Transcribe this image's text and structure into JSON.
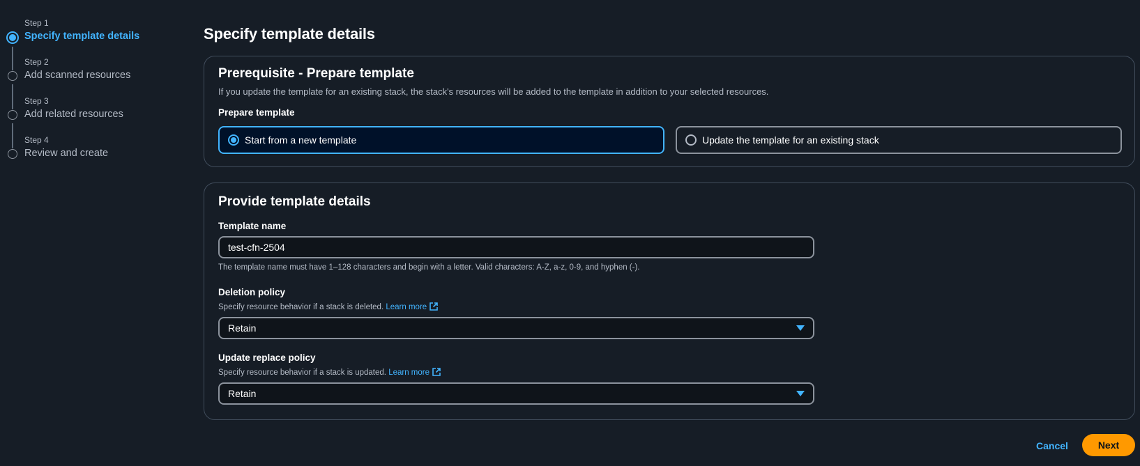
{
  "steps": [
    {
      "sub": "Step 1",
      "title": "Specify template details",
      "active": true
    },
    {
      "sub": "Step 2",
      "title": "Add scanned resources",
      "active": false
    },
    {
      "sub": "Step 3",
      "title": "Add related resources",
      "active": false
    },
    {
      "sub": "Step 4",
      "title": "Review and create",
      "active": false
    }
  ],
  "page_title": "Specify template details",
  "prerequisite": {
    "title": "Prerequisite - Prepare template",
    "description": "If you update the template for an existing stack, the stack's resources will be added to the template in addition to your selected resources.",
    "label": "Prepare template",
    "options": [
      {
        "label": "Start from a new template",
        "selected": true
      },
      {
        "label": "Update the template for an existing stack",
        "selected": false
      }
    ]
  },
  "details": {
    "title": "Provide template details",
    "template_name_label": "Template name",
    "template_name_value": "test-cfn-2504",
    "template_name_help": "The template name must have 1–128 characters and begin with a letter. Valid characters: A-Z, a-z, 0-9, and hyphen (-).",
    "deletion_label": "Deletion policy",
    "deletion_help": "Specify resource behavior if a stack is deleted.",
    "deletion_value": "Retain",
    "update_label": "Update replace policy",
    "update_help": "Specify resource behavior if a stack is updated.",
    "update_value": "Retain",
    "learn_more": "Learn more"
  },
  "footer": {
    "cancel_label": "Cancel",
    "next_label": "Next"
  },
  "colors": {
    "background": "#161d26",
    "accent": "#42b4ff",
    "primary_button": "#ff9900"
  }
}
